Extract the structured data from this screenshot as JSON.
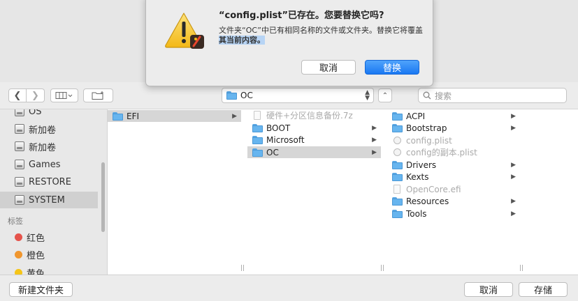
{
  "alert": {
    "title": "“config.plist”已存在。您要替换它吗?",
    "message_line1": "文件夹“OC”中已有相同名称的文件或文件夹。替换它将覆盖",
    "message_line2": "其当前内容。",
    "cancel_label": "取消",
    "replace_label": "替换",
    "icon": "warning-triangle-icon",
    "accent_color": "#1a78f2"
  },
  "toolbar": {
    "back_icon": "chevron-left-icon",
    "forward_icon": "chevron-right-icon",
    "view_icon": "column-view-icon",
    "new_folder_icon": "new-folder-icon",
    "location": "OC",
    "search_placeholder": "搜索"
  },
  "sidebar": {
    "items": [
      {
        "label": "OS",
        "icon": "disk-icon"
      },
      {
        "label": "新加卷",
        "icon": "disk-icon"
      },
      {
        "label": "新加卷",
        "icon": "disk-icon"
      },
      {
        "label": "Games",
        "icon": "disk-icon"
      },
      {
        "label": "RESTORE",
        "icon": "disk-icon"
      },
      {
        "label": "SYSTEM",
        "icon": "disk-icon",
        "selected": true
      }
    ],
    "tags_header": "标签",
    "tags": [
      {
        "label": "红色",
        "color": "#e5534b"
      },
      {
        "label": "橙色",
        "color": "#f0962e"
      },
      {
        "label": "黄色",
        "color": "#f5c518"
      }
    ]
  },
  "columns": {
    "col1": [
      {
        "label": "EFI",
        "type": "folder",
        "selected": true,
        "has_children": true
      }
    ],
    "col2": [
      {
        "label": "硬件+分区信息备份.7z",
        "type": "file",
        "dim": true
      },
      {
        "label": "BOOT",
        "type": "folder",
        "has_children": true
      },
      {
        "label": "Microsoft",
        "type": "folder",
        "has_children": true
      },
      {
        "label": "OC",
        "type": "folder",
        "selected": true,
        "has_children": true
      }
    ],
    "col3": [
      {
        "label": "ACPI",
        "type": "folder",
        "has_children": true
      },
      {
        "label": "Bootstrap",
        "type": "folder",
        "has_children": true
      },
      {
        "label": "config.plist",
        "type": "plist",
        "dim": true
      },
      {
        "label": "config的副本.plist",
        "type": "plist",
        "dim": true
      },
      {
        "label": "Drivers",
        "type": "folder",
        "has_children": true
      },
      {
        "label": "Kexts",
        "type": "folder",
        "has_children": true
      },
      {
        "label": "OpenCore.efi",
        "type": "file",
        "dim": true
      },
      {
        "label": "Resources",
        "type": "folder",
        "has_children": true
      },
      {
        "label": "Tools",
        "type": "folder",
        "has_children": true
      }
    ]
  },
  "bottom": {
    "new_folder_label": "新建文件夹",
    "cancel_label": "取消",
    "save_label": "存储"
  }
}
